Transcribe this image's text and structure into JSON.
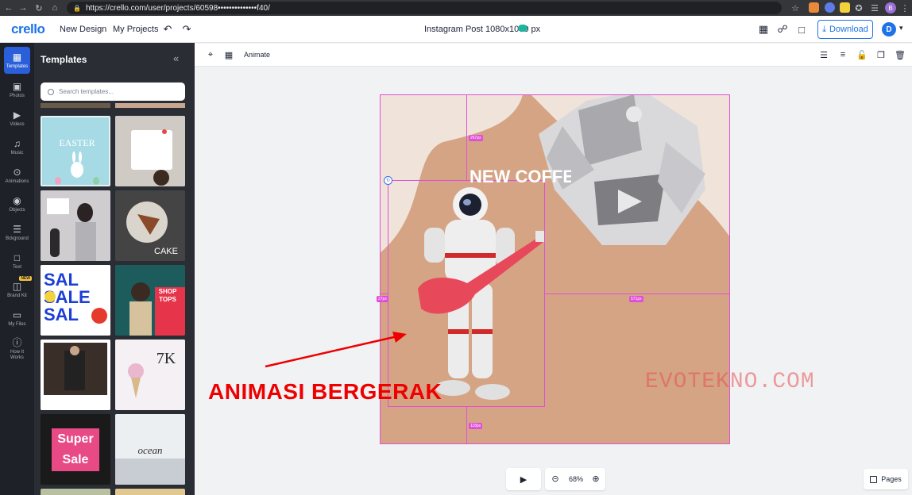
{
  "browser": {
    "url": "https://crello.com/user/projects/60598••••••••••••••f40/",
    "profile_initial": "B"
  },
  "header": {
    "logo": "crello",
    "nav": [
      "New Design",
      "My Projects"
    ],
    "document_title": "Instagram Post 1080x1080 px",
    "download_label": "Download",
    "user_initial": "D"
  },
  "rail": {
    "items": [
      {
        "label": "Templates",
        "icon": "grid-icon",
        "active": true
      },
      {
        "label": "Photos",
        "icon": "photo-icon"
      },
      {
        "label": "Videos",
        "icon": "video-icon"
      },
      {
        "label": "Music",
        "icon": "music-icon"
      },
      {
        "label": "Animations",
        "icon": "animation-icon"
      },
      {
        "label": "Objects",
        "icon": "objects-icon"
      },
      {
        "label": "Bckground",
        "icon": "background-icon"
      },
      {
        "label": "Text",
        "icon": "text-icon"
      },
      {
        "label": "Brand Kit",
        "icon": "brand-kit-icon",
        "badge": "NEW"
      },
      {
        "label": "My Files",
        "icon": "folder-icon"
      },
      {
        "label": "How It Works",
        "icon": "help-icon"
      }
    ]
  },
  "panel": {
    "title": "Templates",
    "search_placeholder": "Search templates..."
  },
  "toolbar": {
    "animate_label": "Animate"
  },
  "canvas": {
    "headline": "NEW COFFE",
    "measures": [
      "267px",
      "27px",
      "571px",
      "118px"
    ]
  },
  "annotation": {
    "text": "ANIMASI BERGERAK"
  },
  "watermark": "EVOTEKNO.COM",
  "controls": {
    "zoom": "68%",
    "pages_label": "Pages"
  },
  "colors": {
    "brand": "#1f73e8",
    "rail_bg": "#1e2128",
    "panel_bg": "#2a2d34",
    "canvas_bg": "#d8a98a",
    "guide": "#e04fd8",
    "annotation": "#ee0000"
  }
}
